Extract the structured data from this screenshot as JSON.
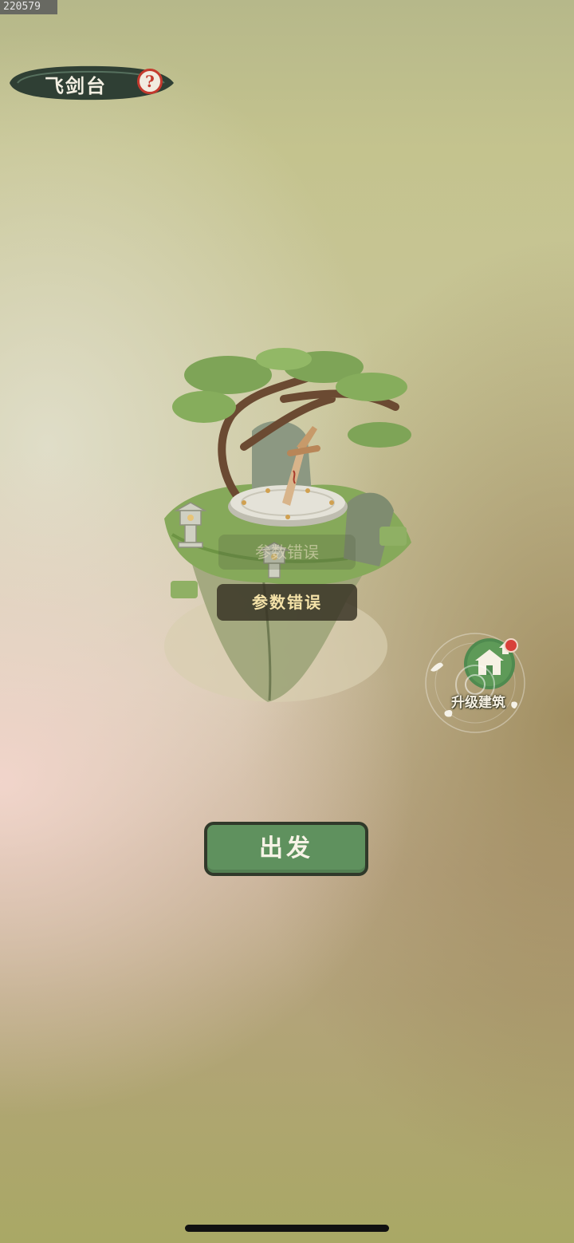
{
  "debug_id": "220579",
  "header": {
    "title": "飞剑台",
    "help_icon": "question-mark-icon"
  },
  "scene": {
    "ghost_label": "参数错误",
    "status_label": "参数错误"
  },
  "upgrade": {
    "label": "升级建筑",
    "icon": "building-upgrade-icon",
    "has_notification": true
  },
  "actions": {
    "depart_label": "出发"
  },
  "colors": {
    "button_green": "#5f915e",
    "banner_dark": "#2f3f34",
    "badge_red": "#d8403a"
  }
}
